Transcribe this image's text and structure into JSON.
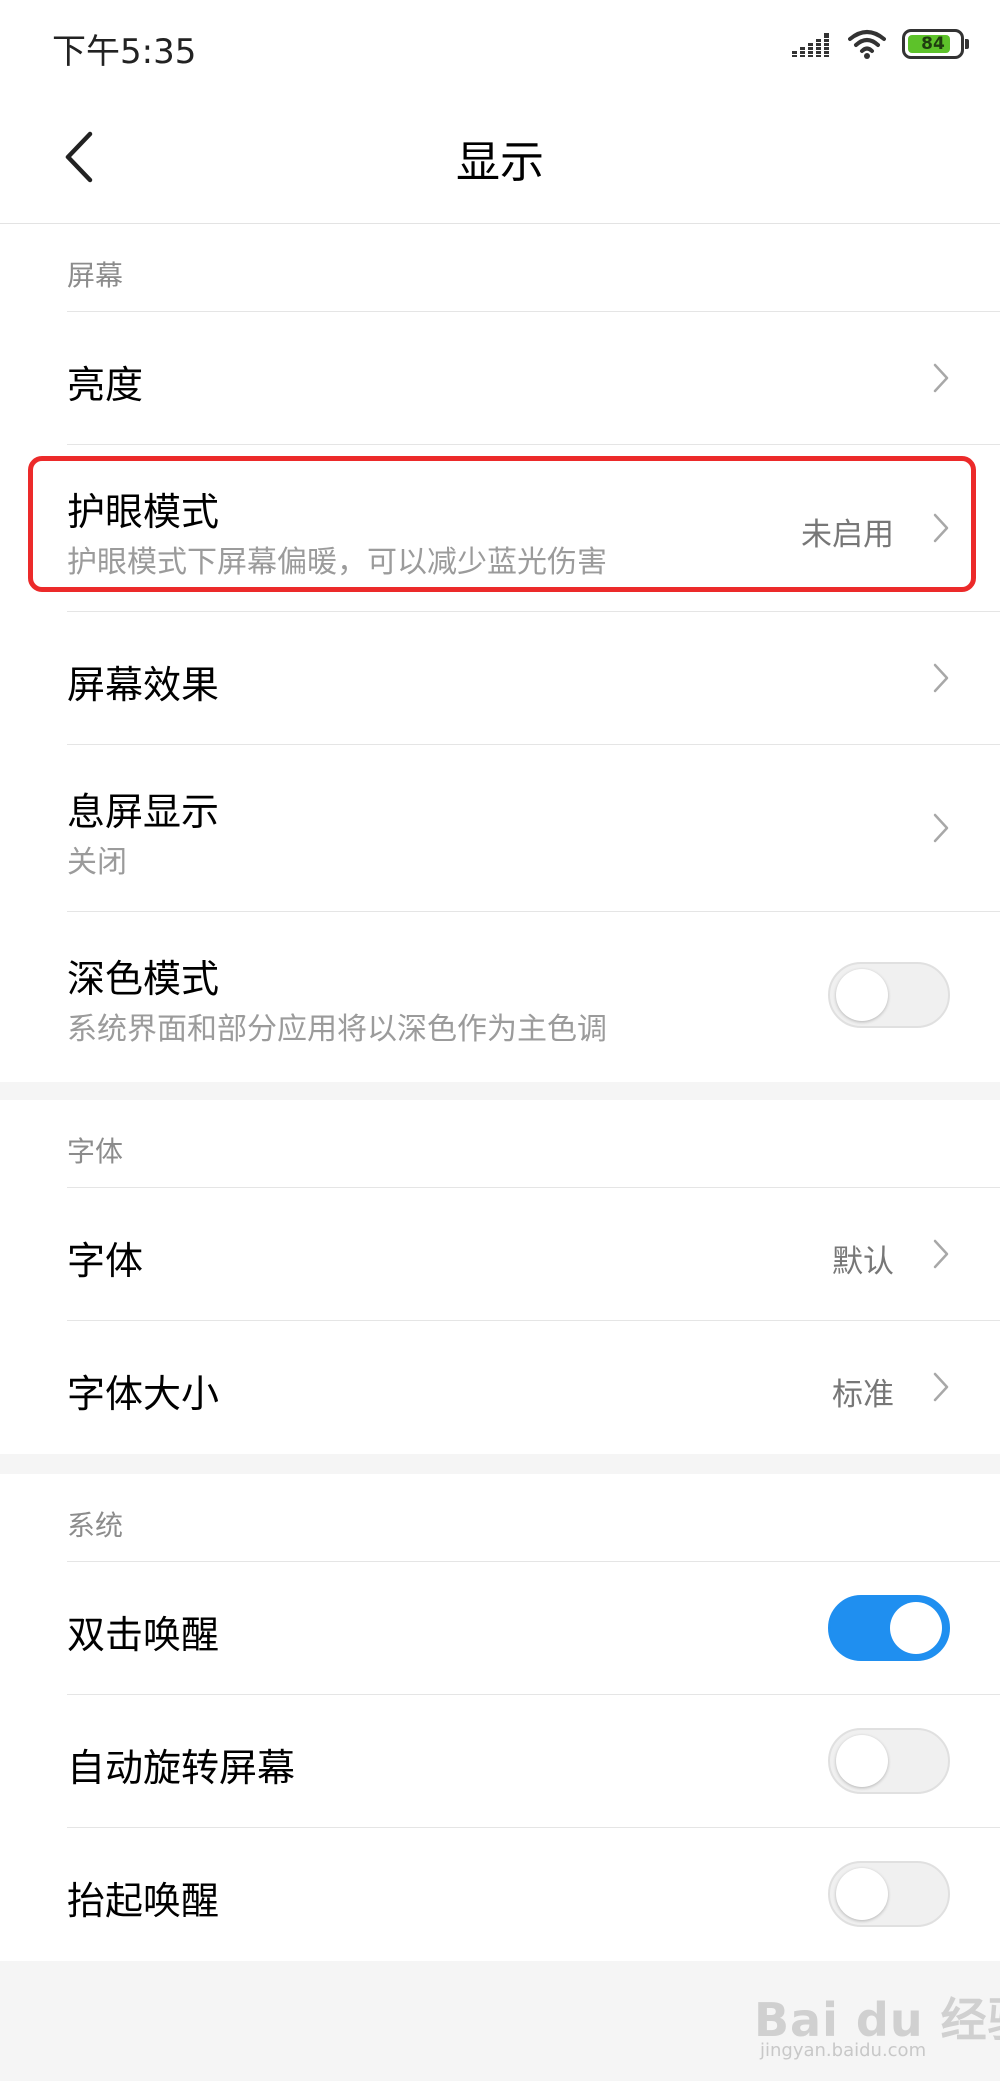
{
  "status_bar": {
    "time": "下午5:35",
    "battery_level": "84",
    "battery_percent": 84,
    "icons": [
      "signal-icon",
      "wifi-icon",
      "battery-icon"
    ]
  },
  "header": {
    "title": "显示",
    "back_icon": "chevron-left-icon"
  },
  "colors": {
    "accent": "#1f8ff0",
    "highlight": "#ec2a2a",
    "battery": "#5dc22a",
    "secondary_text": "#9b9b9b"
  },
  "screen_section": {
    "title": "屏幕",
    "brightness": {
      "title": "亮度"
    },
    "eye_protection": {
      "title": "护眼模式",
      "subtitle": "护眼模式下屏幕偏暖，可以减少蓝光伤害",
      "value": "未启用"
    },
    "screen_effect": {
      "title": "屏幕效果"
    },
    "ambient_display": {
      "title": "息屏显示",
      "subtitle": "关闭"
    },
    "dark_mode": {
      "title": "深色模式",
      "subtitle": "系统界面和部分应用将以深色作为主色调",
      "enabled": false
    }
  },
  "font_section": {
    "title": "字体",
    "font": {
      "title": "字体",
      "value": "默认"
    },
    "font_size": {
      "title": "字体大小",
      "value": "标准"
    }
  },
  "system_section": {
    "title": "系统",
    "double_tap_wake": {
      "title": "双击唤醒",
      "enabled": true
    },
    "auto_rotate": {
      "title": "自动旋转屏幕",
      "enabled": false
    },
    "raise_to_wake": {
      "title": "抬起唤醒",
      "enabled": false
    }
  },
  "watermark": {
    "logo": "Bai du 经验",
    "url": "jingyan.baidu.com"
  }
}
